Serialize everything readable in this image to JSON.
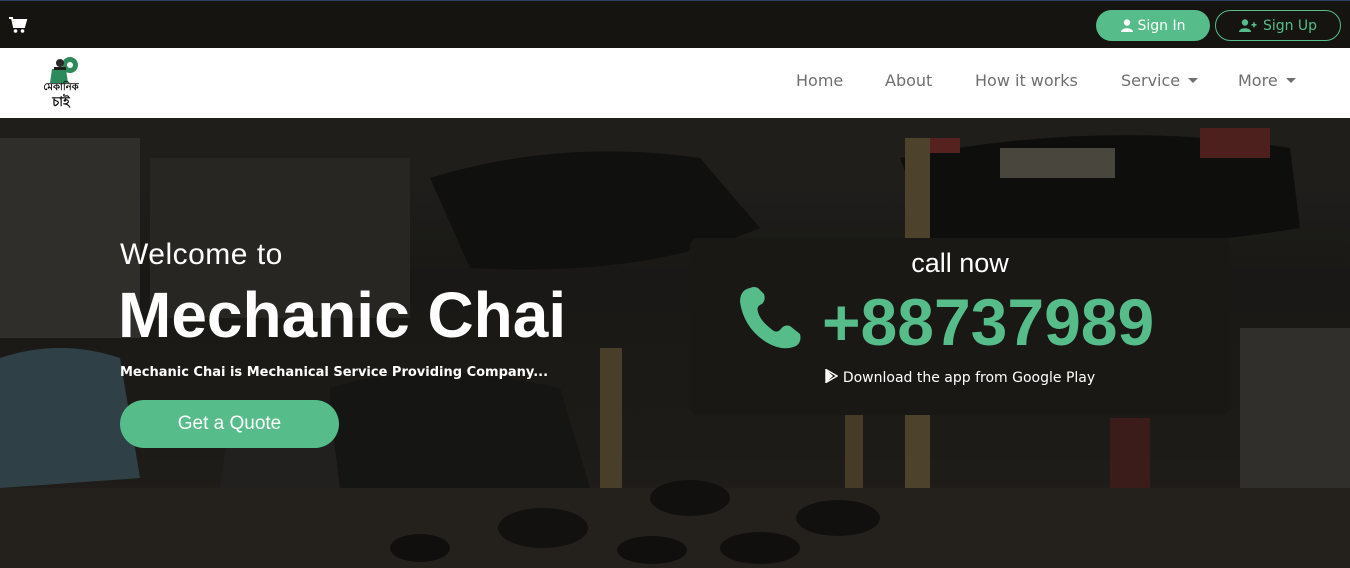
{
  "topbar": {
    "cart_icon": "shopping-cart-icon",
    "signin_label": "Sign In",
    "signin_icon": "user-icon",
    "signup_label": "Sign Up",
    "signup_icon": "user-plus-icon"
  },
  "navbar": {
    "logo_text": "মেকানিক চাই",
    "items": [
      {
        "label": "Home"
      },
      {
        "label": "About"
      },
      {
        "label": "How it works"
      },
      {
        "label": "Service",
        "dropdown": true
      },
      {
        "label": "More",
        "dropdown": true
      }
    ]
  },
  "hero": {
    "welcome": "Welcome to",
    "title": "Mechanic Chai",
    "tagline": "Mechanic Chai is Mechanical Service Providing Company...",
    "quote_button": "Get a Quote"
  },
  "call": {
    "label": "call now",
    "phone": "+88737989",
    "phone_icon": "phone-icon",
    "download_icon": "google-play-icon",
    "download_text": "Download the app from Google Play"
  },
  "colors": {
    "accent": "#56bd8a",
    "topbar": "#161410",
    "navbar": "#ffffff",
    "nav_text": "#6f6f6f"
  }
}
